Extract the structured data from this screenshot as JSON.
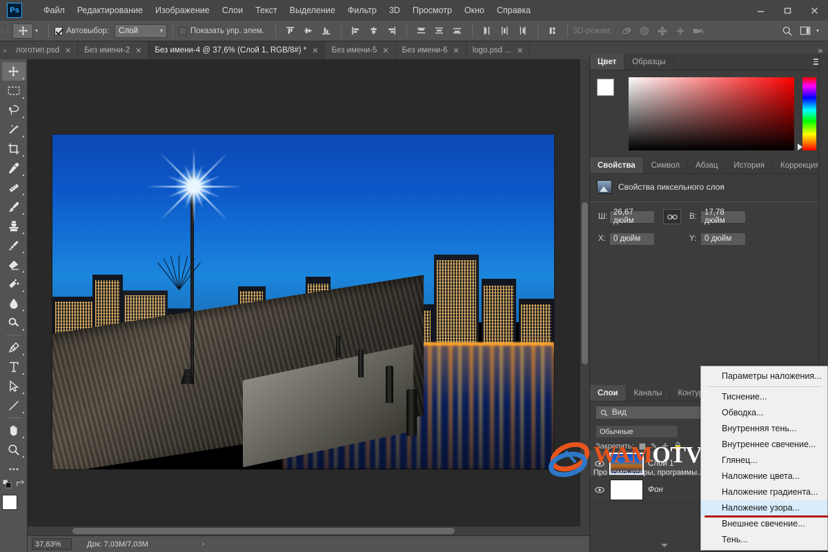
{
  "window": {
    "app_icon": "photoshop-logo",
    "controls": {
      "minimize": "minimize-icon",
      "maximize": "maximize-icon",
      "close": "close-icon"
    }
  },
  "menubar": {
    "items": [
      {
        "label": "Файл"
      },
      {
        "label": "Редактирование"
      },
      {
        "label": "Изображение"
      },
      {
        "label": "Слои"
      },
      {
        "label": "Текст"
      },
      {
        "label": "Выделение"
      },
      {
        "label": "Фильтр"
      },
      {
        "label": "3D"
      },
      {
        "label": "Просмотр"
      },
      {
        "label": "Окно"
      },
      {
        "label": "Справка"
      }
    ]
  },
  "options_bar": {
    "tool_icon": "move-tool-icon",
    "autoselect_label": "Автовыбор:",
    "autoselect_checked": true,
    "autoselect_scope": "Слой",
    "show_controls_label": "Показать упр. элем.",
    "show_controls_checked": false,
    "mode3d_label": "3D-режим:",
    "align_buttons": [
      "align-top-edges",
      "align-vertical-centers",
      "align-bottom-edges",
      "align-left-edges",
      "align-horizontal-centers",
      "align-right-edges"
    ],
    "distribute_buttons": [
      "distribute-top-edges",
      "distribute-vertical-centers",
      "distribute-bottom-edges",
      "distribute-left-edges",
      "distribute-horizontal-centers",
      "distribute-right-edges"
    ],
    "extra_buttons": [
      "auto-align-layers"
    ],
    "mode3d_buttons": [
      "orbit-3d",
      "roll-3d",
      "pan-3d",
      "slide-3d",
      "camera-3d"
    ],
    "right_icons": [
      "search-icon",
      "workspace-icon",
      "chevron-down-icon"
    ]
  },
  "tabs": [
    {
      "label": "логотип.psd",
      "active": false
    },
    {
      "label": "Без имени-2",
      "active": false
    },
    {
      "label": "Без имени-4 @ 37,6% (Слой 1, RGB/8#) *",
      "active": true
    },
    {
      "label": "Без имени-5",
      "active": false
    },
    {
      "label": "Без имени-6",
      "active": false
    },
    {
      "label": "logo.psd ...",
      "active": false
    }
  ],
  "tab_overflow": "»",
  "toolbar": {
    "tools": [
      {
        "name": "move-tool",
        "active": true
      },
      {
        "name": "rectangular-marquee-tool",
        "active": false
      },
      {
        "name": "lasso-tool",
        "active": false
      },
      {
        "name": "magic-wand-tool",
        "active": false
      },
      {
        "name": "crop-tool",
        "active": false
      },
      {
        "name": "eyedropper-tool",
        "active": false
      },
      {
        "name": "healing-brush-tool",
        "active": false
      },
      {
        "name": "brush-tool",
        "active": false
      },
      {
        "name": "clone-stamp-tool",
        "active": false
      },
      {
        "name": "history-brush-tool",
        "active": false
      },
      {
        "name": "eraser-tool",
        "active": false
      },
      {
        "name": "gradient-tool",
        "active": false
      },
      {
        "name": "blur-tool",
        "active": false
      },
      {
        "name": "dodge-tool",
        "active": false
      },
      {
        "name": "pen-tool",
        "active": false
      },
      {
        "name": "type-tool",
        "active": false
      },
      {
        "name": "path-selection-tool",
        "active": false
      },
      {
        "name": "line-tool",
        "active": false
      },
      {
        "name": "hand-tool",
        "active": false
      },
      {
        "name": "zoom-tool",
        "active": false
      },
      {
        "name": "edit-toolbar",
        "active": false
      }
    ],
    "foreground_color": "#ffffff",
    "background_color": "#000000"
  },
  "canvas": {
    "image_description": "Ночная панорама города у набережной с фонарём и отражениями огней в воде"
  },
  "statusbar": {
    "zoom": "37,63%",
    "doc_info": "Док: 7,03M/7,03M",
    "caret": "›"
  },
  "color_panel": {
    "tabs": [
      {
        "label": "Цвет",
        "active": true
      },
      {
        "label": "Образцы",
        "active": false
      }
    ],
    "foreground": "#ffffff",
    "background": "#000000",
    "spectrum_hue": "#ff0000"
  },
  "properties_panel": {
    "tabs": [
      {
        "label": "Свойства",
        "active": true
      },
      {
        "label": "Символ",
        "active": false
      },
      {
        "label": "Абзац",
        "active": false
      },
      {
        "label": "История",
        "active": false
      },
      {
        "label": "Коррекция",
        "active": false
      }
    ],
    "header": "Свойства пиксельного слоя",
    "fields": {
      "w_label": "Ш:",
      "w_value": "26,67 дюйм",
      "h_label": "В:",
      "h_value": "17,78 дюйм",
      "x_label": "X:",
      "x_value": "0 дюйм",
      "y_label": "Y:",
      "y_value": "0 дюйм",
      "link_icon": "link-chain-icon"
    }
  },
  "layers_panel": {
    "tabs": [
      {
        "label": "Слои",
        "active": true
      },
      {
        "label": "Каналы",
        "active": false
      },
      {
        "label": "Контуры",
        "active": false
      }
    ],
    "filter_label": "Вид",
    "filter_icon": "search-icon",
    "blend_mode": "Обычные",
    "lock_label": "Закрепить:",
    "lock_icons": [
      "lock-transparent-pixels",
      "lock-image-pixels",
      "lock-position",
      "lock-all"
    ],
    "layers": [
      {
        "name": "Слой 1",
        "visible": true,
        "selected": true,
        "thumb": "city-photo"
      },
      {
        "name": "Фон",
        "visible": true,
        "selected": false,
        "thumb": "white",
        "italic": true
      }
    ],
    "footer_icon": "link-layers-icon"
  },
  "context_menu": {
    "items": [
      {
        "label": "Параметры наложения...",
        "highlighted": false,
        "separator_after": true
      },
      {
        "label": "Тиснение...",
        "highlighted": false
      },
      {
        "label": "Обводка...",
        "highlighted": false
      },
      {
        "label": "Внутренняя тень...",
        "highlighted": false
      },
      {
        "label": "Внутреннее свечение...",
        "highlighted": false
      },
      {
        "label": "Глянец...",
        "highlighted": false
      },
      {
        "label": "Наложение цвета...",
        "highlighted": false
      },
      {
        "label": "Наложение градиента...",
        "highlighted": false
      },
      {
        "label": "Наложение узора...",
        "highlighted": true
      },
      {
        "label": "Внешнее свечение...",
        "highlighted": false
      },
      {
        "label": "Тень...",
        "highlighted": false
      }
    ]
  },
  "watermark": {
    "title_part1": "WAM",
    "title_part2": "OTVET.RU",
    "subtitle": "Про компьютеры, программы...",
    "color_primary": "#e8551c",
    "color_secondary": "#2f77c8"
  }
}
